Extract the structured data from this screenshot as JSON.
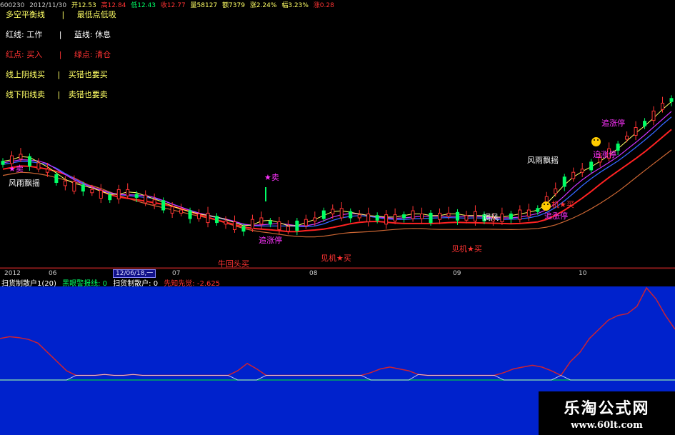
{
  "header": {
    "code": "600230",
    "date": "2012/11/30",
    "open": "开12.53",
    "high": "高12.84",
    "low": "低12.43",
    "close": "收12.77",
    "volume": "量58127",
    "amount": "额7379",
    "change": "涨2.24%",
    "amplitude": "幅3.23%",
    "rise": "涨0.28"
  },
  "legend": {
    "line1_a": "多空平衡线",
    "line1_b": "最低点低吸",
    "line2_a": "红线: 工作",
    "line2_b": "蓝线: 休息",
    "line3_a": "红点: 买入",
    "line3_b": "绿点: 清仓",
    "line4_a": "线上阴线买",
    "line4_b": "买错也要买",
    "line5_a": "线下阳线卖",
    "line5_b": "卖错也要卖",
    "separator": "|"
  },
  "annotations": [
    {
      "text": "★卖",
      "color": "#ff33ff"
    },
    {
      "text": "风雨飘摇",
      "color": "#ffffff"
    },
    {
      "text": "★卖",
      "color": "#ff33ff"
    },
    {
      "text": "追涨停",
      "color": "#ff33ff"
    },
    {
      "text": "牛回头买",
      "color": "#ff3333"
    },
    {
      "text": "见机★买",
      "color": "#ff3333"
    },
    {
      "text": "见机★买",
      "color": "#ff3333"
    },
    {
      "text": "风雨飘摇",
      "color": "#ffffff"
    },
    {
      "text": "追涨停",
      "color": "#ff33ff"
    },
    {
      "text": "追涨停",
      "color": "#ff33ff"
    },
    {
      "text": "机★买",
      "color": "#ff3333"
    },
    {
      "text": "追涨停",
      "color": "#ff33ff"
    },
    {
      "text": "调风",
      "color": "#ffffff"
    }
  ],
  "axis": {
    "date_box": "12/06/18,一",
    "months": [
      "2012",
      "06",
      "07",
      "08",
      "09",
      "10"
    ]
  },
  "sub_legend": {
    "a": "扫货制散户1(20)",
    "b": "黑眼警报线: 0",
    "c": "扫货制散户: 0",
    "d": "先知先觉: -2.625"
  },
  "watermark": {
    "title": "乐淘公式网",
    "url": "www.60lt.com"
  },
  "colors": {
    "up": "#ff3333",
    "down": "#00ff66",
    "ma_yellow": "#ffff66",
    "ma_magenta": "#cc33ff",
    "ma_blue": "#3366ff",
    "ma_red": "#ff2222",
    "ma_orange": "#cc6633",
    "sub_bg": "#0022cc"
  },
  "chart_data": [
    {
      "type": "candlestick",
      "title": "",
      "months": [
        "2012",
        "06",
        "07",
        "08",
        "09",
        "10"
      ],
      "note_range": [
        0,
        100
      ],
      "price_path": [
        60,
        62,
        64,
        61,
        58,
        55,
        50,
        47,
        45,
        44,
        42,
        40,
        38,
        40,
        41,
        39,
        37,
        35,
        33,
        30,
        29,
        27,
        26,
        25,
        24,
        22,
        20,
        18,
        21,
        23,
        22,
        20,
        18,
        20,
        22,
        24,
        27,
        29,
        28,
        27,
        26,
        25,
        25,
        24,
        25,
        26,
        27,
        26,
        25,
        26,
        27,
        26,
        25,
        26,
        25,
        24,
        25,
        26,
        27,
        28,
        30,
        36,
        42,
        48,
        52,
        55,
        58,
        62,
        66,
        70,
        76,
        80,
        85,
        90,
        96,
        100
      ]
    },
    {
      "type": "line",
      "title": "",
      "ylim": [
        0,
        100
      ],
      "series": [
        {
          "values": [
            45,
            47,
            46,
            44,
            40,
            30,
            20,
            10,
            5,
            5,
            5,
            6,
            5,
            5,
            6,
            5,
            5,
            5,
            5,
            5,
            5,
            5,
            5,
            5,
            5,
            10,
            18,
            12,
            5,
            5,
            5,
            5,
            5,
            5,
            5,
            5,
            5,
            5,
            5,
            8,
            12,
            14,
            12,
            10,
            6,
            5,
            5,
            5,
            5,
            5,
            5,
            5,
            5,
            8,
            12,
            14,
            16,
            14,
            10,
            5,
            20,
            30,
            45,
            55,
            65,
            70,
            72,
            80,
            100,
            88,
            70,
            55
          ]
        },
        {
          "values": [
            0,
            0,
            0,
            0,
            0,
            0,
            0,
            0,
            0,
            0,
            0,
            0,
            0,
            0,
            0,
            0,
            0,
            0,
            0,
            0,
            0,
            0,
            0,
            0,
            0,
            0,
            0,
            0,
            0,
            0,
            0,
            0,
            0,
            0,
            0,
            0,
            0,
            0,
            0,
            0,
            0,
            0,
            0,
            0,
            0,
            0,
            0,
            0,
            0,
            0,
            0,
            0,
            0,
            0,
            0,
            0,
            0,
            0,
            0,
            0,
            0,
            0,
            0,
            0,
            0,
            0,
            0,
            0,
            0,
            0,
            0,
            0
          ]
        }
      ]
    }
  ]
}
